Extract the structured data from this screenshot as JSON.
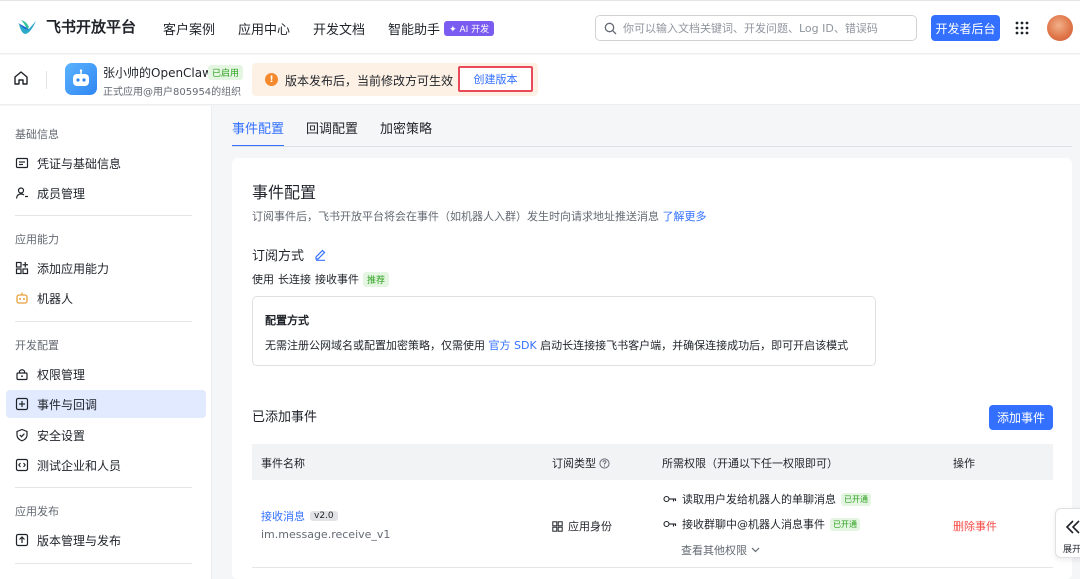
{
  "brand": {
    "name": "飞书开放平台"
  },
  "nav": {
    "links": [
      "客户案例",
      "应用中心",
      "开发文档",
      "智能助手"
    ],
    "ai_badge": "✦ AI 开发",
    "search_placeholder": "你可以输入文档关键词、开发问题、Log ID、错误码",
    "developer_console": "开发者后台"
  },
  "app": {
    "name": "张小帅的OpenClaw",
    "status": "已启用",
    "subtitle": "正式应用@用户805954的组织"
  },
  "notice": {
    "icon_text": "!",
    "text": "版本发布后，当前修改方可生效",
    "button": "创建版本"
  },
  "sidebar": {
    "sections": [
      {
        "title": "基础信息",
        "items": [
          "凭证与基础信息",
          "成员管理"
        ]
      },
      {
        "title": "应用能力",
        "items": [
          "添加应用能力",
          "机器人"
        ]
      },
      {
        "title": "开发配置",
        "items": [
          "权限管理",
          "事件与回调",
          "安全设置",
          "测试企业和人员"
        ]
      },
      {
        "title": "应用发布",
        "items": [
          "版本管理与发布"
        ]
      }
    ],
    "active_item": "事件与回调"
  },
  "tabs": [
    "事件配置",
    "回调配置",
    "加密策略"
  ],
  "active_tab": "事件配置",
  "main": {
    "title": "事件配置",
    "desc_prefix": "订阅事件后，飞书开放平台将会在事件（如机器人入群）发生时向请求地址推送消息",
    "desc_link": "了解更多",
    "subscription_title": "订阅方式",
    "mode_prefix": "使用",
    "mode_value": "长连接",
    "mode_suffix": "接收事件",
    "mode_tag": "推荐",
    "config_title": "配置方式",
    "config_desc_prefix": "无需注册公网域名或配置加密策略，仅需使用",
    "config_link": "官方 SDK",
    "config_desc_suffix": "启动长连接接飞书客户端，并确保连接成功后，即可开启该模式",
    "added_title": "已添加事件",
    "add_button": "添加事件"
  },
  "table": {
    "headers": [
      "事件名称",
      "订阅类型",
      "所需权限（开通以下任一权限即可）",
      "操作"
    ],
    "rows": [
      {
        "name": "接收消息",
        "version": "v2.0",
        "code": "im.message.receive_v1",
        "type": "应用身份",
        "permissions": [
          {
            "label": "读取用户发给机器人的单聊消息",
            "status": "已开通"
          },
          {
            "label": "接收群聊中@机器人消息事件",
            "status": "已开通"
          }
        ],
        "more": "查看其他权限",
        "action": "删除事件"
      }
    ]
  },
  "expand": {
    "label": "展开"
  },
  "colors": {
    "accent": "#3370ff",
    "danger": "#f54a45",
    "success": "#2ea121",
    "warning": "#f5892d"
  }
}
